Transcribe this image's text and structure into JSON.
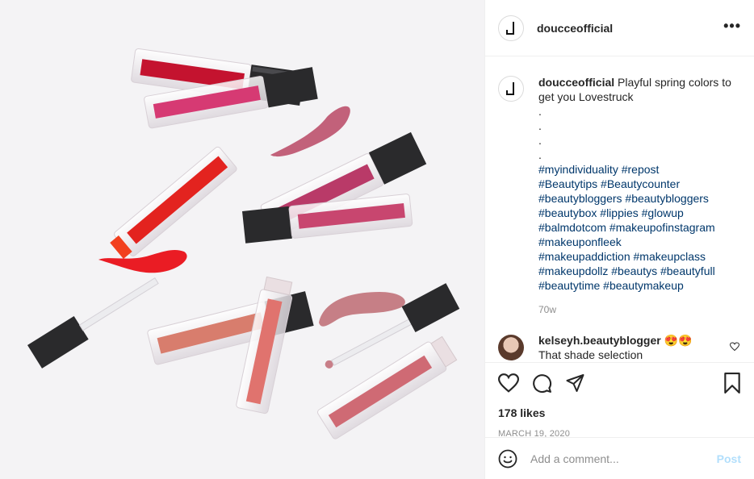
{
  "post": {
    "username": "doucceofficial",
    "more_label": "•••",
    "caption": {
      "username": "doucceofficial",
      "text": "Playful spring colors to get you Lovestruck",
      "dots": [
        ".",
        ".",
        ".",
        "."
      ],
      "hashtag_lines": [
        "#myindividuality #repost",
        "#Beautytips #Beautycounter",
        "#beautybloggers #beautybloggers",
        "#beautybox #lippies #glowup",
        "#balmdotcom #makeupofinstagram",
        "#makeuponfleek",
        "#makeupaddiction #makeupclass",
        "#makeupdollz #beautys #beautyfull",
        "#beautytime #beautymakeup"
      ],
      "age": "70w"
    },
    "comment": {
      "username": "kelseyh.beautyblogger",
      "emoji": "😍😍",
      "text": "That shade selection"
    },
    "likes": "178 likes",
    "date": "MARCH 19, 2020",
    "add_comment": {
      "placeholder": "Add a comment...",
      "post_label": "Post"
    }
  },
  "icons": {
    "like": "heart-icon",
    "comment": "comment-icon",
    "share": "send-icon",
    "save": "bookmark-icon",
    "emoji": "smiley-icon"
  },
  "colors": {
    "hashtag": "#00376b",
    "muted": "#8e8e8e",
    "post_button": "#b2dffc"
  }
}
